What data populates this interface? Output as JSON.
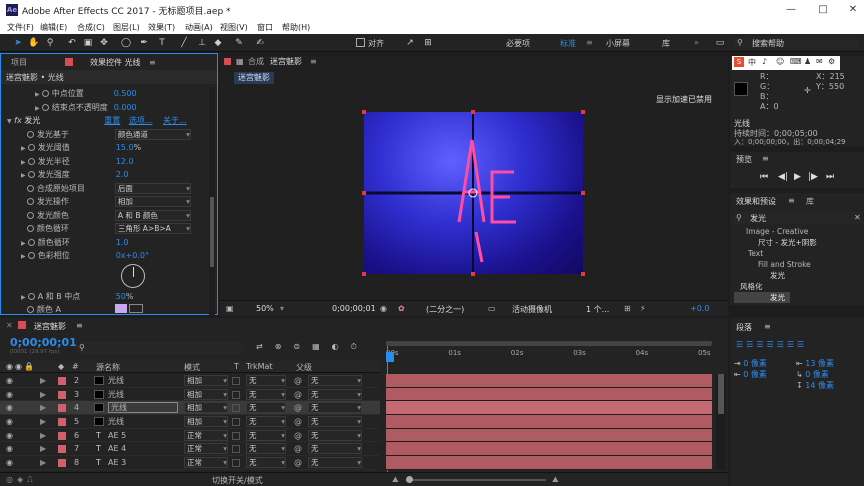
{
  "titlebar": {
    "title": "Adobe After Effects CC 2017 - 无标题项目.aep *",
    "logo": "Ae",
    "min": "—",
    "max": "□",
    "close": "✕"
  },
  "menu": [
    "文件(F)",
    "编辑(E)",
    "合成(C)",
    "图层(L)",
    "效果(T)",
    "动画(A)",
    "视图(V)",
    "窗口",
    "帮助(H)"
  ],
  "toolbar": {
    "snap": "对齐",
    "workspaces": [
      "必要项",
      "标准",
      "小屏幕",
      "库"
    ],
    "active_ws": "标准",
    "search": "搜索帮助",
    "ime": [
      "中",
      "♪",
      "☺",
      "⌨",
      "♟",
      "✉",
      "⚙"
    ]
  },
  "left_panel": {
    "tabs": [
      "项目",
      "效果控件 光线"
    ],
    "breadcrumb": "迷宫魅影 • 光线",
    "rows": [
      {
        "label": "中点位置",
        "value": "0.500"
      },
      {
        "label": "结束点不透明度",
        "value": "0.000"
      }
    ],
    "effect": {
      "name": "发光",
      "reset": "重置",
      "options": "选项...",
      "about": "关于..."
    },
    "props": [
      {
        "label": "发光基于",
        "value": "颜色通道",
        "type": "dd"
      },
      {
        "label": "发光阈值",
        "value": "15.0",
        "unit": "%",
        "type": "num"
      },
      {
        "label": "发光半径",
        "value": "12.0",
        "type": "num"
      },
      {
        "label": "发光强度",
        "value": "2.0",
        "type": "num"
      },
      {
        "label": "合成原始项目",
        "value": "后面",
        "type": "dd"
      },
      {
        "label": "发光操作",
        "value": "相加",
        "type": "dd"
      },
      {
        "label": "发光颜色",
        "value": "A 和 B 颜色",
        "type": "dd"
      },
      {
        "label": "颜色循环",
        "value": "三角形 A>B>A",
        "type": "dd"
      },
      {
        "label": "颜色循环",
        "value": "1.0",
        "type": "num"
      },
      {
        "label": "色彩相位",
        "value": "0x+0.0°",
        "type": "num"
      },
      {
        "label": "A 和 B 中点",
        "value": "50",
        "unit": "%",
        "type": "num"
      },
      {
        "label": "颜色 A",
        "value": "",
        "type": "color"
      }
    ]
  },
  "comp": {
    "tab_prefix": "合成",
    "tab_name": "迷宫魅影",
    "subtab": "迷宫魅影",
    "hw_note": "显示加速已禁用",
    "bottom": {
      "zoom": "50%",
      "time": "0;00;00;01",
      "res": "(二分之一)",
      "camera": "活动摄像机",
      "views": "1 个...",
      "offset": "+0.0"
    }
  },
  "info": {
    "r": "R：",
    "g": "G：",
    "b": "B：",
    "a": "A：0",
    "x": "X：215",
    "y": "Y：550"
  },
  "right_panels": {
    "glow_title": "光线",
    "duration": "持续时间：0;00;05;00",
    "in_out": "入：0;00;00;00，出：0;00;04;29",
    "preview": "预览",
    "effects": "效果和预设",
    "library": "库",
    "search": "发光",
    "tree": [
      "Image - Creative",
      "尺寸 - 发光+阴影",
      "Text",
      "Fill and Stroke",
      "发光",
      "风格化",
      "发光"
    ],
    "paragraph": "段落",
    "para_vals": [
      "0 像素",
      "0 像素",
      "13 像素",
      "0 像素",
      "14 像素"
    ]
  },
  "timeline": {
    "tab": "迷宫魅影",
    "timecode": "0;00;00;01",
    "fps": "00001 (29.97 fps)",
    "cols": {
      "name": "源名称",
      "mode": "模式",
      "t": "T",
      "trk": "TrkMat",
      "parent": "父级"
    },
    "ruler": [
      "00s",
      "01s",
      "02s",
      "03s",
      "04s",
      "05s"
    ],
    "footer": "切换开关/模式",
    "layers": [
      {
        "num": "2",
        "type": "solid",
        "name": "光线",
        "mode": "相加",
        "trk": "无",
        "parent": "无",
        "selected": false
      },
      {
        "num": "3",
        "type": "solid",
        "name": "光线",
        "mode": "相加",
        "trk": "无",
        "parent": "无",
        "selected": false
      },
      {
        "num": "4",
        "type": "solid",
        "name": "光线",
        "mode": "相加",
        "trk": "无",
        "parent": "无",
        "selected": true
      },
      {
        "num": "5",
        "type": "solid",
        "name": "光线",
        "mode": "相加",
        "trk": "无",
        "parent": "无",
        "selected": false
      },
      {
        "num": "6",
        "type": "text",
        "name": "AE 5",
        "mode": "正常",
        "trk": "无",
        "parent": "无",
        "selected": false
      },
      {
        "num": "7",
        "type": "text",
        "name": "AE 4",
        "mode": "正常",
        "trk": "无",
        "parent": "无",
        "selected": false
      },
      {
        "num": "8",
        "type": "text",
        "name": "AE 3",
        "mode": "正常",
        "trk": "无",
        "parent": "无",
        "selected": false
      }
    ]
  },
  "colors": {
    "accent": "#2d8ceb",
    "layer_bar": "#b05a62",
    "label": "#d0606c",
    "panel": "#232323"
  }
}
